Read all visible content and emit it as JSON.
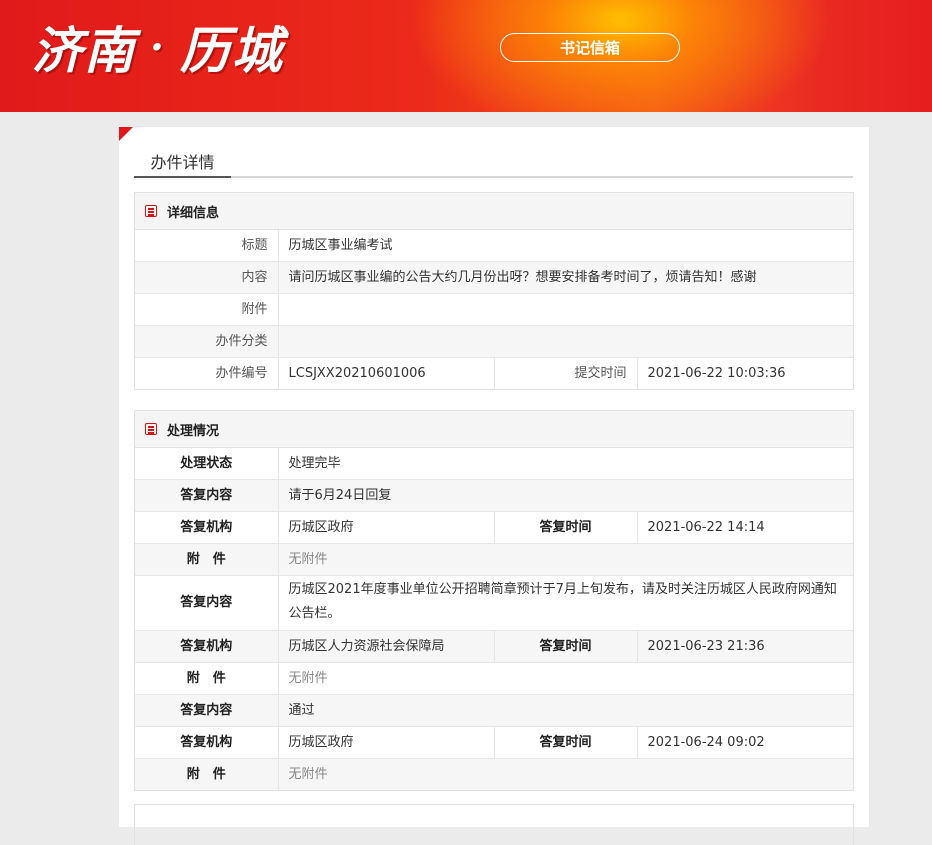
{
  "header": {
    "logo_part1": "济南",
    "logo_sep": "·",
    "logo_part2": "历城",
    "mailbox_button": "书记信箱"
  },
  "page_tab": "办件详情",
  "detail": {
    "section_title": "详细信息",
    "labels": {
      "title": "标题",
      "content": "内容",
      "attachment": "附件",
      "category": "办件分类",
      "case_no": "办件编号",
      "submit_time": "提交时间"
    },
    "values": {
      "title": "历城区事业编考试",
      "content": "请问历城区事业编的公告大约几月份出呀？想要安排备考时间了，烦请告知！感谢",
      "attachment": "",
      "category": "",
      "case_no": "LCSJXX20210601006",
      "submit_time": "2021-06-22 10:03:36"
    }
  },
  "handling": {
    "section_title": "处理情况",
    "status_label": "处理状态",
    "status_value": "处理完毕",
    "labels": {
      "reply_content": "答复内容",
      "reply_org": "答复机构",
      "reply_time": "答复时间",
      "attachment": "附　件"
    },
    "replies": [
      {
        "content": "请于6月24日回复",
        "org": "历城区政府",
        "time": "2021-06-22 14:14",
        "attachment": "无附件"
      },
      {
        "content": "历城区2021年度事业单位公开招聘简章预计于7月上旬发布，请及时关注历城区人民政府网通知公告栏。",
        "org": "历城区人力资源社会保障局",
        "time": "2021-06-23 21:36",
        "attachment": "无附件"
      },
      {
        "content": "通过",
        "org": "历城区政府",
        "time": "2021-06-24 09:02",
        "attachment": "无附件"
      }
    ]
  },
  "colors": {
    "brand_red": "#e0161b",
    "banner_glow": "#ffc400"
  }
}
